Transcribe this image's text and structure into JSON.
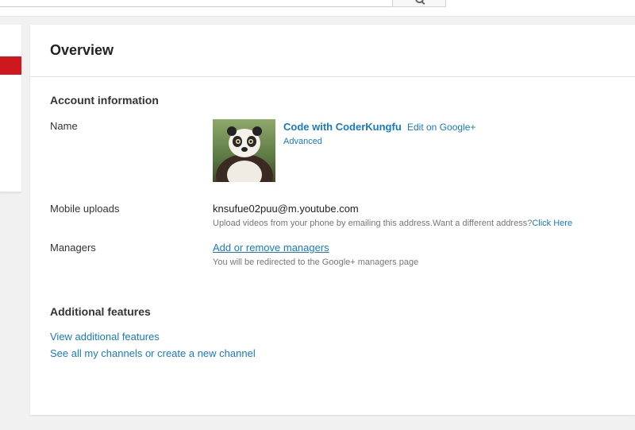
{
  "overview": {
    "title": "Overview"
  },
  "account_information": {
    "heading": "Account information",
    "name": {
      "label": "Name",
      "channel_name": "Code with CoderKungfu",
      "edit_link": "Edit on Google+",
      "advanced_link": "Advanced",
      "avatar_icon": "panda-avatar"
    },
    "mobile_uploads": {
      "label": "Mobile uploads",
      "email": "knsufue02puu@m.youtube.com",
      "hint": "Upload videos from your phone by emailing this address.Want a different address?",
      "hint_link": "Click Here"
    },
    "managers": {
      "label": "Managers",
      "link": "Add or remove managers",
      "hint": "You will be redirected to the Google+ managers page"
    }
  },
  "additional_features": {
    "heading": "Additional features",
    "links": [
      "View additional features",
      "See all my channels or create a new channel"
    ]
  },
  "colors": {
    "link": "#167ac6",
    "accent_red": "#cc181e"
  },
  "icons": {
    "search_button": "search-icon"
  }
}
